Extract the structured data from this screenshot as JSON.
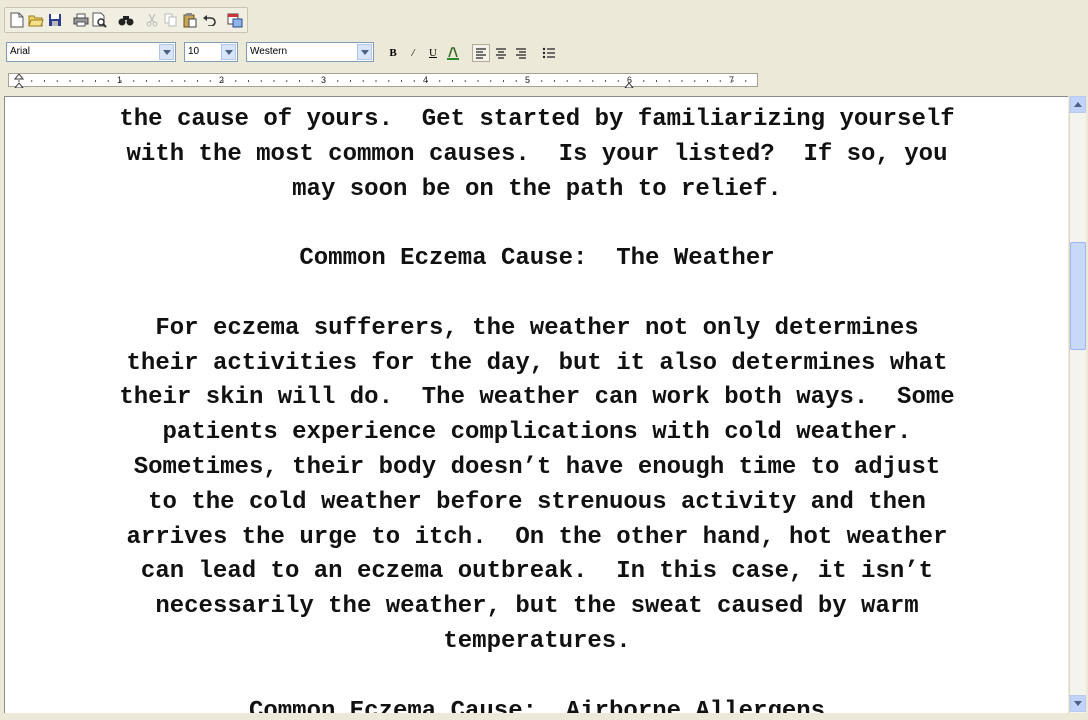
{
  "toolbar": {
    "icons": [
      "new-document-icon",
      "open-folder-icon",
      "save-icon",
      "print-icon",
      "print-preview-icon",
      "find-icon",
      "cut-icon",
      "copy-icon",
      "paste-icon",
      "undo-icon",
      "insert-date-icon"
    ]
  },
  "format_bar": {
    "font_name": "Arial",
    "font_size": "10",
    "script": "Western",
    "bold": "B",
    "italic": "/",
    "underline": "U",
    "align_left": "left",
    "align_center": "center",
    "align_right": "right",
    "bullets": "bullets"
  },
  "ruler": {
    "numbers": [
      "1",
      "2",
      "3",
      "4",
      "5",
      "6",
      "7"
    ]
  },
  "document": {
    "lines": [
      "the cause of yours.  Get started by familiarizing yourself",
      "with the most common causes.  Is your listed?  If so, you",
      "may soon be on the path to relief.",
      "",
      "Common Eczema Cause:  The Weather",
      "",
      "For eczema sufferers, the weather not only determines",
      "their activities for the day, but it also determines what",
      "their skin will do.  The weather can work both ways.  Some",
      "patients experience complications with cold weather.",
      "Sometimes, their body doesn’t have enough time to adjust",
      "to the cold weather before strenuous activity and then",
      "arrives the urge to itch.  On the other hand, hot weather",
      "can lead to an eczema outbreak.  In this case, it isn’t",
      "necessarily the weather, but the sweat caused by warm",
      "temperatures.",
      "",
      "Common Eczema Cause:  Airborne Allergens"
    ]
  }
}
